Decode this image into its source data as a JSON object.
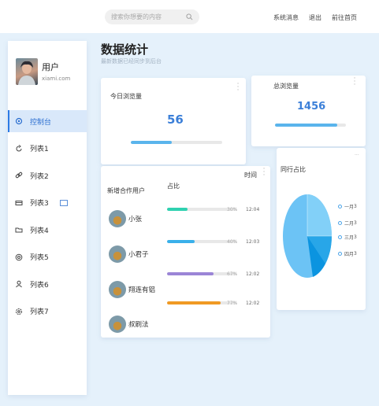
{
  "header": {
    "search_placeholder": "搜索你想要的内容",
    "links": [
      "系统消息",
      "退出",
      "前往首页"
    ]
  },
  "sidebar": {
    "user": {
      "name": "用户",
      "email": "xiami.com"
    },
    "items": [
      {
        "label": "控制台",
        "icon": "gear-icon",
        "active": true
      },
      {
        "label": "列表1",
        "icon": "refresh-icon"
      },
      {
        "label": "列表2",
        "icon": "link-icon"
      },
      {
        "label": "列表3",
        "icon": "card-icon",
        "badge": true
      },
      {
        "label": "列表4",
        "icon": "folder-icon"
      },
      {
        "label": "列表5",
        "icon": "target-icon"
      },
      {
        "label": "列表6",
        "icon": "user-icon"
      },
      {
        "label": "列表7",
        "icon": "settings-icon"
      }
    ]
  },
  "page": {
    "title": "数据统计",
    "subtitle": "最新数据已经同步到后台"
  },
  "stats": [
    {
      "title": "今日浏览量",
      "value": "56",
      "progress": 0.45
    },
    {
      "title": "总浏览量",
      "value": "1456",
      "progress": 0.88
    }
  ],
  "table": {
    "title": "新增合作用户",
    "col_ratio": "占比",
    "col_time": "时间",
    "rows": [
      {
        "name": "小张",
        "pct": "30%",
        "time": "12:04",
        "value": 0.3,
        "color": "#2fd1b0"
      },
      {
        "name": "小君子",
        "pct": "40%",
        "time": "12:03",
        "value": 0.4,
        "color": "#3ab0ea"
      },
      {
        "name": "翔连有铝",
        "pct": "67%",
        "time": "12:02",
        "value": 0.67,
        "color": "#9b85d6"
      },
      {
        "name": "叔刷法",
        "pct": "77%",
        "time": "12:02",
        "value": 0.77,
        "color": "#f09a24"
      }
    ]
  },
  "pie": {
    "title": "同行占比",
    "legend": [
      {
        "label": "一月",
        "value": "3"
      },
      {
        "label": "二月",
        "value": "3"
      },
      {
        "label": "三月",
        "value": "3"
      },
      {
        "label": "四月",
        "value": "3"
      }
    ]
  },
  "colors": {
    "accent": "#2c7be5",
    "stat_value": "#3b7fd8",
    "bar": "#5ab4ec"
  }
}
